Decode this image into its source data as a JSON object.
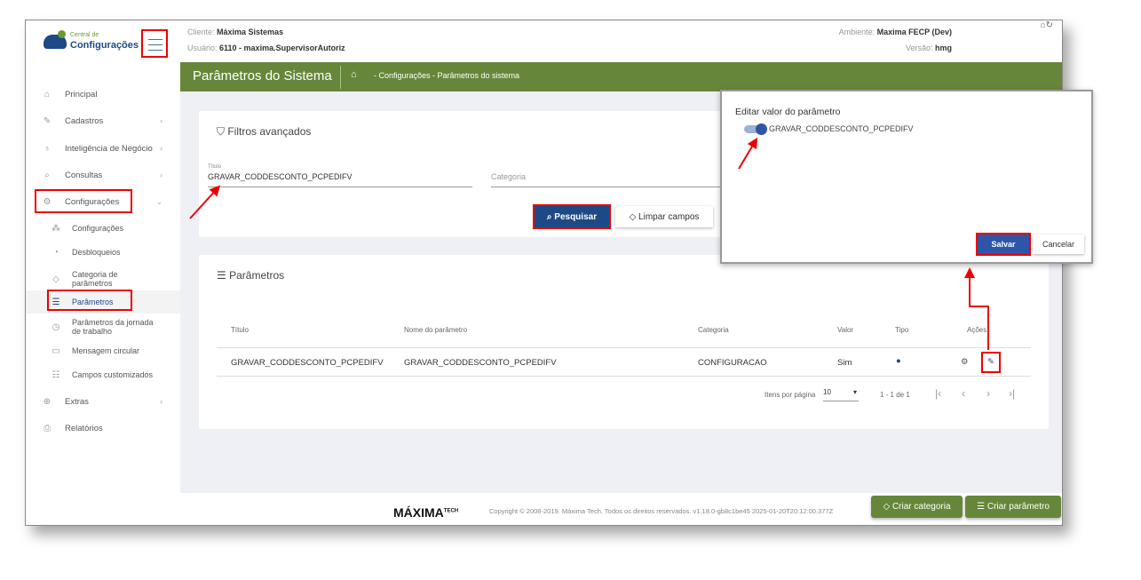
{
  "logo": {
    "line1": "Central de",
    "line2": "Configurações"
  },
  "header": {
    "client_label": "Cliente:",
    "client": "Máxima Sistemas",
    "user_label": "Usuário:",
    "user": "6110 - maxima.SupervisorAutoriz",
    "env_label": "Ambiente:",
    "env": "Maxima FECP (Dev)",
    "version_label": "Versão:",
    "version": "hmg"
  },
  "sidebar": {
    "items": [
      {
        "label": "Principal"
      },
      {
        "label": "Cadastros"
      },
      {
        "label": "Inteligência de Negócio"
      },
      {
        "label": "Consultas"
      },
      {
        "label": "Configurações"
      }
    ],
    "sub": [
      {
        "label": "Configurações"
      },
      {
        "label": "Desbloqueios"
      },
      {
        "label": "Categoria de parâmetros"
      },
      {
        "label": "Parâmetros"
      },
      {
        "label": "Parâmetros da jornada de trabalho"
      },
      {
        "label": "Mensagem circular"
      },
      {
        "label": "Campos customizados"
      }
    ],
    "extras": "Extras",
    "reports": "Relatórios"
  },
  "page": {
    "title": "Parâmetros do Sistema",
    "breadcrumb": "- Configurações - Parâmetros do sistema"
  },
  "filters": {
    "title": "Filtros avançados",
    "titulo_label": "Título",
    "titulo_value": "GRAVAR_CODDESCONTO_PCPEDIFV",
    "categoria_placeholder": "Categoria",
    "search": "Pesquisar",
    "clear": "Limpar campos"
  },
  "params": {
    "title": "Parâmetros",
    "columns": [
      "Título",
      "Nome do parâmetro",
      "Categoria",
      "Valor",
      "Tipo",
      "Ações"
    ],
    "rows": [
      {
        "titulo": "GRAVAR_CODDESCONTO_PCPEDIFV",
        "nome": "GRAVAR_CODDESCONTO_PCPEDIFV",
        "categoria": "CONFIGURACAO",
        "valor": "Sim"
      }
    ],
    "per_page_label": "Itens por página",
    "per_page": "10",
    "range": "1 - 1 de 1"
  },
  "footer": {
    "copyright": "Copyright © 2008-2019. Máxima Tech. Todos os direitos reservados. v1.18.0-gb8c1be45 2025-01-20T20:12:00.377Z",
    "brand": "MÁXIMA",
    "brand_sub": "TECH",
    "create_category": "Criar categoria",
    "create_param": "Criar parâmetro"
  },
  "modal": {
    "title": "Editar valor do parâmetro",
    "param": "GRAVAR_CODDESCONTO_PCPEDIFV",
    "toggle_on": true,
    "save": "Salvar",
    "cancel": "Cancelar"
  }
}
